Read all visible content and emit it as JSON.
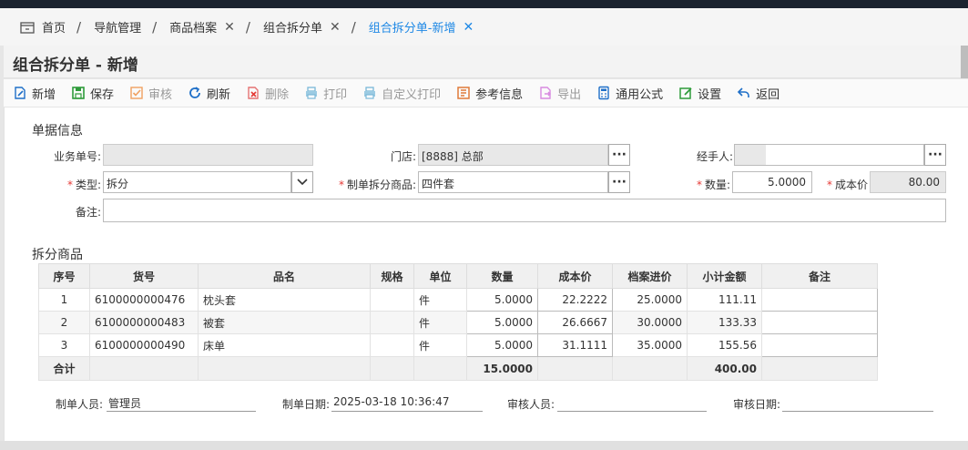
{
  "breadcrumbs": [
    {
      "label": "首页"
    },
    {
      "label": "导航管理"
    },
    {
      "label": "商品档案"
    },
    {
      "label": "组合拆分单"
    },
    {
      "label": "组合拆分单-新增"
    }
  ],
  "page_title": "组合拆分单 - 新增",
  "toolbar": {
    "new": "新增",
    "save": "保存",
    "audit": "审核",
    "refresh": "刷新",
    "delete": "删除",
    "print": "打印",
    "custom_print": "自定义打印",
    "reference": "参考信息",
    "export": "导出",
    "formula": "通用公式",
    "settings": "设置",
    "back": "返回"
  },
  "header_section": {
    "title": "单据信息",
    "doc_no_label": "业务单号:",
    "doc_no_value": "",
    "store_label": "门店:",
    "store_value": "[8888] 总部",
    "handler_label": "经手人:",
    "handler_value": "",
    "type_label": "类型:",
    "type_value": "拆分",
    "product_label": "制单拆分商品:",
    "product_value": "四件套",
    "qty_label": "数量:",
    "qty_value": "5.0000",
    "cost_label": "成本价",
    "cost_value": "80.00",
    "remark_label": "备注:",
    "remark_value": ""
  },
  "items_section": {
    "title": "拆分商品",
    "columns": [
      "序号",
      "货号",
      "品名",
      "规格",
      "单位",
      "数量",
      "成本价",
      "档案进价",
      "小计金额",
      "备注"
    ],
    "rows": [
      {
        "no": "1",
        "code": "6100000000476",
        "name": "枕头套",
        "spec": "",
        "unit": "件",
        "qty": "5.0000",
        "cost": "22.2222",
        "archive_price": "25.0000",
        "subtotal": "111.11",
        "remark": ""
      },
      {
        "no": "2",
        "code": "6100000000483",
        "name": "被套",
        "spec": "",
        "unit": "件",
        "qty": "5.0000",
        "cost": "26.6667",
        "archive_price": "30.0000",
        "subtotal": "133.33",
        "remark": ""
      },
      {
        "no": "3",
        "code": "6100000000490",
        "name": "床单",
        "spec": "",
        "unit": "件",
        "qty": "5.0000",
        "cost": "31.1111",
        "archive_price": "35.0000",
        "subtotal": "155.56",
        "remark": ""
      }
    ],
    "total": {
      "label": "合计",
      "qty": "15.0000",
      "subtotal": "400.00"
    }
  },
  "footer": {
    "creator_label": "制单人员:",
    "creator_value": "管理员",
    "created_date_label": "制单日期:",
    "created_date_value": "2025-03-18 10:36:47",
    "auditor_label": "审核人员:",
    "auditor_value": "",
    "audit_date_label": "审核日期:",
    "audit_date_value": ""
  },
  "colors": {
    "active_tab": "#1e88e5",
    "required_mark": "#e53935",
    "topbar": "#1b2330"
  }
}
